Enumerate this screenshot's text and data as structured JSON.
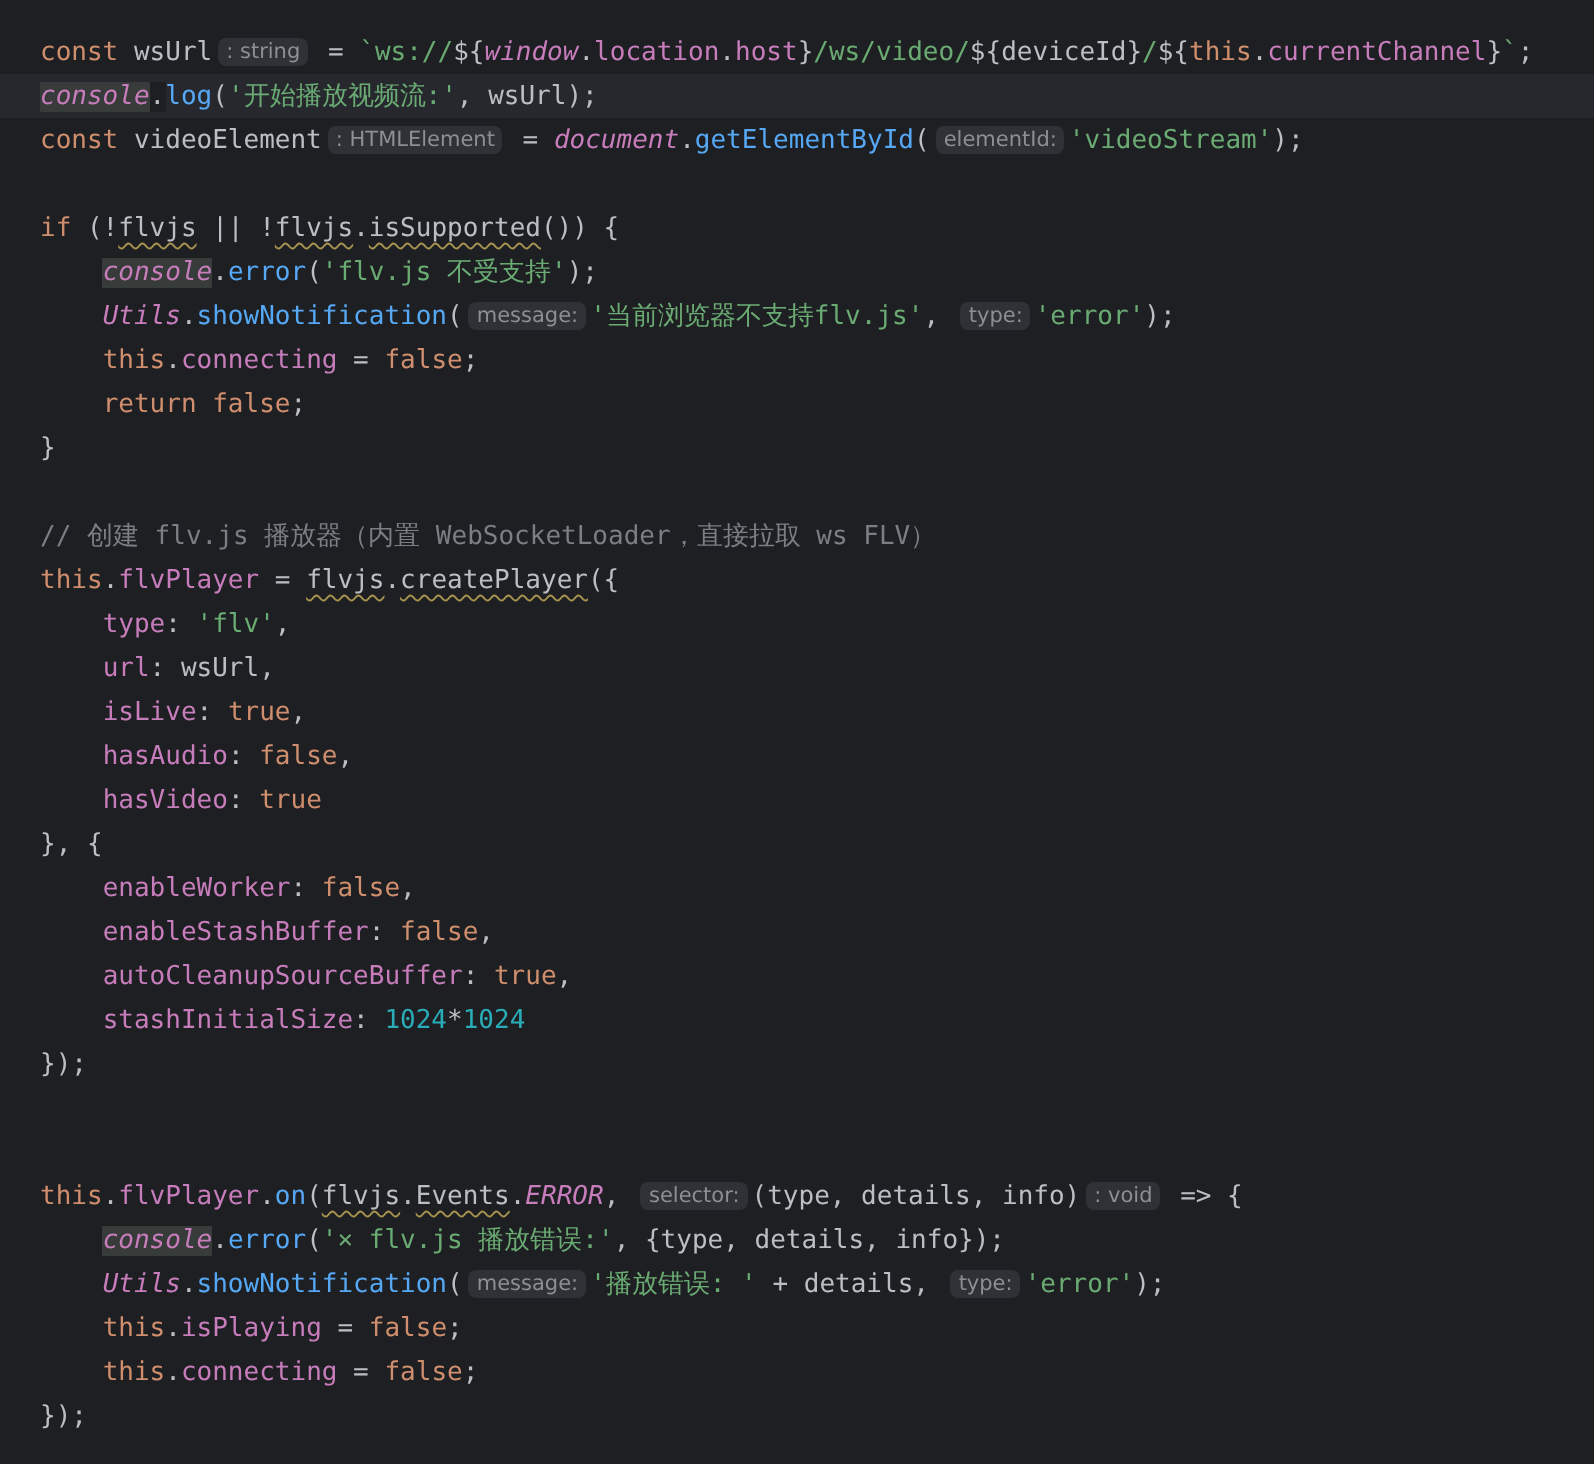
{
  "editor": {
    "lines": [
      {
        "kind": "code",
        "current": false,
        "tokens": [
          {
            "kind": "keyword",
            "text": "const "
          },
          {
            "kind": "plain",
            "text": "wsUrl"
          },
          {
            "kind": "hint",
            "text": ": string"
          },
          {
            "kind": "plain",
            "text": " = "
          },
          {
            "kind": "string",
            "text": "`ws://"
          },
          {
            "kind": "plain",
            "text": "${"
          },
          {
            "kind": "global",
            "text": "window"
          },
          {
            "kind": "plain",
            "text": "."
          },
          {
            "kind": "prop",
            "text": "location"
          },
          {
            "kind": "plain",
            "text": "."
          },
          {
            "kind": "prop",
            "text": "host"
          },
          {
            "kind": "plain",
            "text": "}"
          },
          {
            "kind": "string",
            "text": "/ws/video/"
          },
          {
            "kind": "plain",
            "text": "${deviceId}"
          },
          {
            "kind": "string",
            "text": "/"
          },
          {
            "kind": "plain",
            "text": "${"
          },
          {
            "kind": "keyword",
            "text": "this"
          },
          {
            "kind": "plain",
            "text": "."
          },
          {
            "kind": "prop",
            "text": "currentChannel"
          },
          {
            "kind": "plain",
            "text": "}"
          },
          {
            "kind": "string",
            "text": "`"
          },
          {
            "kind": "plain",
            "text": ";"
          }
        ]
      },
      {
        "kind": "code",
        "current": true,
        "tokens": [
          {
            "kind": "global",
            "text": "console",
            "highlighted": true,
            "suffix": "."
          },
          {
            "kind": "fn",
            "text": "log"
          },
          {
            "kind": "plain",
            "text": "("
          },
          {
            "kind": "string",
            "text": "'开始播放视频流:'"
          },
          {
            "kind": "plain",
            "text": ", wsUrl);"
          }
        ]
      },
      {
        "kind": "code",
        "current": false,
        "tokens": [
          {
            "kind": "keyword",
            "text": "const "
          },
          {
            "kind": "plain",
            "text": "videoElement"
          },
          {
            "kind": "hint",
            "text": ": HTMLElement"
          },
          {
            "kind": "plain",
            "text": " = "
          },
          {
            "kind": "global",
            "text": "document"
          },
          {
            "kind": "plain",
            "text": "."
          },
          {
            "kind": "fn",
            "text": "getElementById"
          },
          {
            "kind": "plain",
            "text": "("
          },
          {
            "kind": "hint",
            "text": "elementId:"
          },
          {
            "kind": "string",
            "text": "'videoStream'"
          },
          {
            "kind": "plain",
            "text": ");"
          }
        ]
      },
      {
        "kind": "blank"
      },
      {
        "kind": "code",
        "current": false,
        "tokens": [
          {
            "kind": "keyword",
            "text": "if "
          },
          {
            "kind": "plain",
            "text": "(!"
          },
          {
            "kind": "plain",
            "text": "flvjs",
            "warning": true
          },
          {
            "kind": "plain",
            "text": " || !"
          },
          {
            "kind": "plain",
            "text": "flvjs",
            "warning": true,
            "suffix": "."
          },
          {
            "kind": "plain",
            "text": "isSupported",
            "warning": true
          },
          {
            "kind": "plain",
            "text": "()) {"
          }
        ]
      },
      {
        "kind": "indented",
        "current": false,
        "tokens": [
          {
            "kind": "global",
            "text": "console",
            "highlighted": true
          },
          {
            "kind": "plain",
            "text": "."
          },
          {
            "kind": "fn",
            "text": "error"
          },
          {
            "kind": "plain",
            "text": "("
          },
          {
            "kind": "string",
            "text": "'flv.js 不受支持'"
          },
          {
            "kind": "plain",
            "text": ");"
          }
        ]
      },
      {
        "kind": "indented",
        "current": false,
        "tokens": [
          {
            "kind": "global",
            "text": "Utils"
          },
          {
            "kind": "plain",
            "text": "."
          },
          {
            "kind": "fn",
            "text": "showNotification"
          },
          {
            "kind": "plain",
            "text": "("
          },
          {
            "kind": "hint",
            "text": "message:"
          },
          {
            "kind": "string",
            "text": "'当前浏览器不支持flv.js'"
          },
          {
            "kind": "plain",
            "text": ", "
          },
          {
            "kind": "hint",
            "text": "type:"
          },
          {
            "kind": "string",
            "text": "'error'"
          },
          {
            "kind": "plain",
            "text": ");"
          }
        ]
      },
      {
        "kind": "indented",
        "current": false,
        "tokens": [
          {
            "kind": "keyword",
            "text": "this"
          },
          {
            "kind": "plain",
            "text": "."
          },
          {
            "kind": "prop",
            "text": "connecting"
          },
          {
            "kind": "plain",
            "text": " = "
          },
          {
            "kind": "keyword",
            "text": "false"
          },
          {
            "kind": "plain",
            "text": ";"
          }
        ]
      },
      {
        "kind": "indented",
        "current": false,
        "tokens": [
          {
            "kind": "keyword",
            "text": "return false"
          },
          {
            "kind": "plain",
            "text": ";"
          }
        ]
      },
      {
        "kind": "code",
        "current": false,
        "tokens": [
          {
            "kind": "plain",
            "text": "}"
          }
        ]
      },
      {
        "kind": "blank"
      },
      {
        "kind": "code",
        "current": false,
        "tokens": [
          {
            "kind": "comment",
            "text": "// 创建 flv.js 播放器（内置 WebSocketLoader，直接拉取 ws FLV）"
          }
        ]
      },
      {
        "kind": "code",
        "current": false,
        "tokens": [
          {
            "kind": "keyword",
            "text": "this"
          },
          {
            "kind": "plain",
            "text": "."
          },
          {
            "kind": "prop",
            "text": "flvPlayer"
          },
          {
            "kind": "plain",
            "text": " = "
          },
          {
            "kind": "plain",
            "text": "flvjs",
            "warning": true
          },
          {
            "kind": "plain",
            "text": "."
          },
          {
            "kind": "plain",
            "text": "createPlayer",
            "warning": true
          },
          {
            "kind": "plain",
            "text": "({"
          }
        ]
      },
      {
        "kind": "indented",
        "current": false,
        "tokens": [
          {
            "kind": "prop",
            "text": "type"
          },
          {
            "kind": "plain",
            "text": ": "
          },
          {
            "kind": "string",
            "text": "'flv'"
          },
          {
            "kind": "plain",
            "text": ","
          }
        ]
      },
      {
        "kind": "indented",
        "current": false,
        "tokens": [
          {
            "kind": "prop",
            "text": "url"
          },
          {
            "kind": "plain",
            "text": ": wsUrl,"
          }
        ]
      },
      {
        "kind": "indented",
        "current": false,
        "tokens": [
          {
            "kind": "prop",
            "text": "isLive"
          },
          {
            "kind": "plain",
            "text": ": "
          },
          {
            "kind": "keyword",
            "text": "true"
          },
          {
            "kind": "plain",
            "text": ","
          }
        ]
      },
      {
        "kind": "indented",
        "current": false,
        "tokens": [
          {
            "kind": "prop",
            "text": "hasAudio"
          },
          {
            "kind": "plain",
            "text": ": "
          },
          {
            "kind": "keyword",
            "text": "false"
          },
          {
            "kind": "plain",
            "text": ","
          }
        ]
      },
      {
        "kind": "indented",
        "current": false,
        "tokens": [
          {
            "kind": "prop",
            "text": "hasVideo"
          },
          {
            "kind": "plain",
            "text": ": "
          },
          {
            "kind": "keyword",
            "text": "true"
          }
        ]
      },
      {
        "kind": "code",
        "current": false,
        "tokens": [
          {
            "kind": "plain",
            "text": "}, {"
          }
        ]
      },
      {
        "kind": "indented",
        "current": false,
        "tokens": [
          {
            "kind": "prop",
            "text": "enableWorker"
          },
          {
            "kind": "plain",
            "text": ": "
          },
          {
            "kind": "keyword",
            "text": "false"
          },
          {
            "kind": "plain",
            "text": ","
          }
        ]
      },
      {
        "kind": "indented",
        "current": false,
        "tokens": [
          {
            "kind": "prop",
            "text": "enableStashBuffer"
          },
          {
            "kind": "plain",
            "text": ": "
          },
          {
            "kind": "keyword",
            "text": "false"
          },
          {
            "kind": "plain",
            "text": ","
          }
        ]
      },
      {
        "kind": "indented",
        "current": false,
        "tokens": [
          {
            "kind": "prop",
            "text": "autoCleanupSourceBuffer"
          },
          {
            "kind": "plain",
            "text": ": "
          },
          {
            "kind": "keyword",
            "text": "true"
          },
          {
            "kind": "plain",
            "text": ","
          }
        ]
      },
      {
        "kind": "indented",
        "current": false,
        "tokens": [
          {
            "kind": "prop",
            "text": "stashInitialSize"
          },
          {
            "kind": "plain",
            "text": ": "
          },
          {
            "kind": "number",
            "text": "1024"
          },
          {
            "kind": "plain",
            "text": "*"
          },
          {
            "kind": "number",
            "text": "1024"
          }
        ]
      },
      {
        "kind": "code",
        "current": false,
        "tokens": [
          {
            "kind": "plain",
            "text": "});"
          }
        ]
      },
      {
        "kind": "blank"
      },
      {
        "kind": "blank"
      },
      {
        "kind": "code",
        "current": false,
        "tokens": [
          {
            "kind": "keyword",
            "text": "this"
          },
          {
            "kind": "plain",
            "text": "."
          },
          {
            "kind": "prop",
            "text": "flvPlayer"
          },
          {
            "kind": "plain",
            "text": "."
          },
          {
            "kind": "fn",
            "text": "on"
          },
          {
            "kind": "plain",
            "text": "("
          },
          {
            "kind": "plain",
            "text": "flvjs",
            "warning": true
          },
          {
            "kind": "plain",
            "text": "."
          },
          {
            "kind": "plain",
            "text": "Events",
            "warning": true
          },
          {
            "kind": "plain",
            "text": "."
          },
          {
            "kind": "global",
            "text": "ERROR"
          },
          {
            "kind": "plain",
            "text": ", "
          },
          {
            "kind": "hint",
            "text": "selector:"
          },
          {
            "kind": "plain",
            "text": "(type, details, info)"
          },
          {
            "kind": "hint",
            "text": ": void"
          },
          {
            "kind": "plain",
            "text": " => {"
          }
        ]
      },
      {
        "kind": "indented",
        "current": false,
        "tokens": [
          {
            "kind": "global",
            "text": "console",
            "highlighted": true
          },
          {
            "kind": "plain",
            "text": "."
          },
          {
            "kind": "fn",
            "text": "error"
          },
          {
            "kind": "plain",
            "text": "("
          },
          {
            "kind": "string",
            "text": "'× flv.js 播放错误:'"
          },
          {
            "kind": "plain",
            "text": ", {type, details, info});"
          }
        ]
      },
      {
        "kind": "indented",
        "current": false,
        "tokens": [
          {
            "kind": "global",
            "text": "Utils"
          },
          {
            "kind": "plain",
            "text": "."
          },
          {
            "kind": "fn",
            "text": "showNotification"
          },
          {
            "kind": "plain",
            "text": "("
          },
          {
            "kind": "hint",
            "text": "message:"
          },
          {
            "kind": "string",
            "text": "'播放错误: '"
          },
          {
            "kind": "plain",
            "text": " + details, "
          },
          {
            "kind": "hint",
            "text": "type:"
          },
          {
            "kind": "string",
            "text": "'error'"
          },
          {
            "kind": "plain",
            "text": ");"
          }
        ]
      },
      {
        "kind": "indented",
        "current": false,
        "tokens": [
          {
            "kind": "keyword",
            "text": "this"
          },
          {
            "kind": "plain",
            "text": "."
          },
          {
            "kind": "prop",
            "text": "isPlaying"
          },
          {
            "kind": "plain",
            "text": " = "
          },
          {
            "kind": "keyword",
            "text": "false"
          },
          {
            "kind": "plain",
            "text": ";"
          }
        ]
      },
      {
        "kind": "indented",
        "current": false,
        "tokens": [
          {
            "kind": "keyword",
            "text": "this"
          },
          {
            "kind": "plain",
            "text": "."
          },
          {
            "kind": "prop",
            "text": "connecting"
          },
          {
            "kind": "plain",
            "text": " = "
          },
          {
            "kind": "keyword",
            "text": "false"
          },
          {
            "kind": "plain",
            "text": ";"
          }
        ]
      },
      {
        "kind": "code",
        "current": false,
        "tokens": [
          {
            "kind": "plain",
            "text": "});"
          }
        ]
      }
    ]
  }
}
